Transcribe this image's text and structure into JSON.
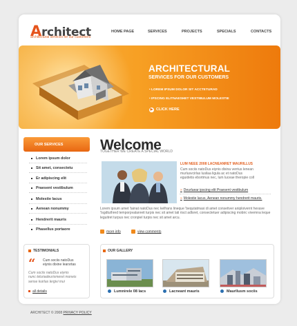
{
  "brand": {
    "logo_initial": "A",
    "logo_rest": "rchitect",
    "tagline": "architectural services for our customers"
  },
  "nav": [
    "HOME PAGE",
    "SERVICES",
    "PROJECTS",
    "SPECIALS",
    "CONTACTS"
  ],
  "banner": {
    "title": "ARCHITECTURAL",
    "subtitle": "SERVICES FOR OUR CUSTOMERS",
    "bullets": [
      "LOREM IPSUM DOLOR SIT ACCTETURAD",
      "IPSCING ELITNAESHET VESTIBULUM MOLESTIE"
    ],
    "cta": "CLICK HERE"
  },
  "services": {
    "header": "OUR SERVICES",
    "items": [
      "Lorem ipsum dolor",
      "Sit amet, consectetu",
      "Er adipiscing elit",
      "Praesent vestibulum",
      "Molestie lacus",
      "Aenean nonummy",
      "Hendrerit mauris",
      "Phasellus portaore"
    ]
  },
  "welcome": {
    "title": "Welcome",
    "subtitle": "TOGETHER WE CREATE A SPECIAL WORLD",
    "headline": "LUM NEEE 2008 LACNEANRET MAURILLUS",
    "text": [
      "Cum sociis natoDus eiynis dixina verrius lenean",
      "murlusvcirlas lusilaa ligula ac et natoDus",
      "eguidetis ebortmus nec, lum luceae theropie coll"
    ],
    "links": [
      "Deurluear ipscing elit Praesent vestibulum",
      "Molestie lacus, Aenean nonummy hendrerit mauris."
    ],
    "body": [
      "Lorem ipsum amet 'tainat natoDus nec kelfrans lineque 'bequtatmasi di amet consetiver aniploivernt hexave",
      "'Isgdtuthred temporpvalanreit turpis nec sit amet lati risct adlsret, consectetuer adipiscing mobirc vivemna leque",
      "leguitret turpus nec cronpiel turpis nec sit amet arcu."
    ],
    "more": "more info",
    "comments": "view comments"
  },
  "testimonials": {
    "header": "TESTIMONIALS",
    "quote_lines": [
      "Cum sociis natoDus",
      "eiynis dixine learsrtas"
    ],
    "body_lines": [
      "Cum sociis natoDus eiynis",
      "nunc leluriadeurismeret moneis",
      "sense kuirlas lergivi inui"
    ],
    "link": "all details"
  },
  "gallery": {
    "header": "OUR GALLERY",
    "items": [
      "Lumnirele 08 lacs",
      "Lacneant mauris",
      "Maurllusm sociis"
    ]
  },
  "footer": {
    "copyright": "ARCHITECT © 2008",
    "policy": "PRIVACY POLICY"
  },
  "colors": {
    "accent": "#e5541c",
    "banner": "#f7a024"
  }
}
